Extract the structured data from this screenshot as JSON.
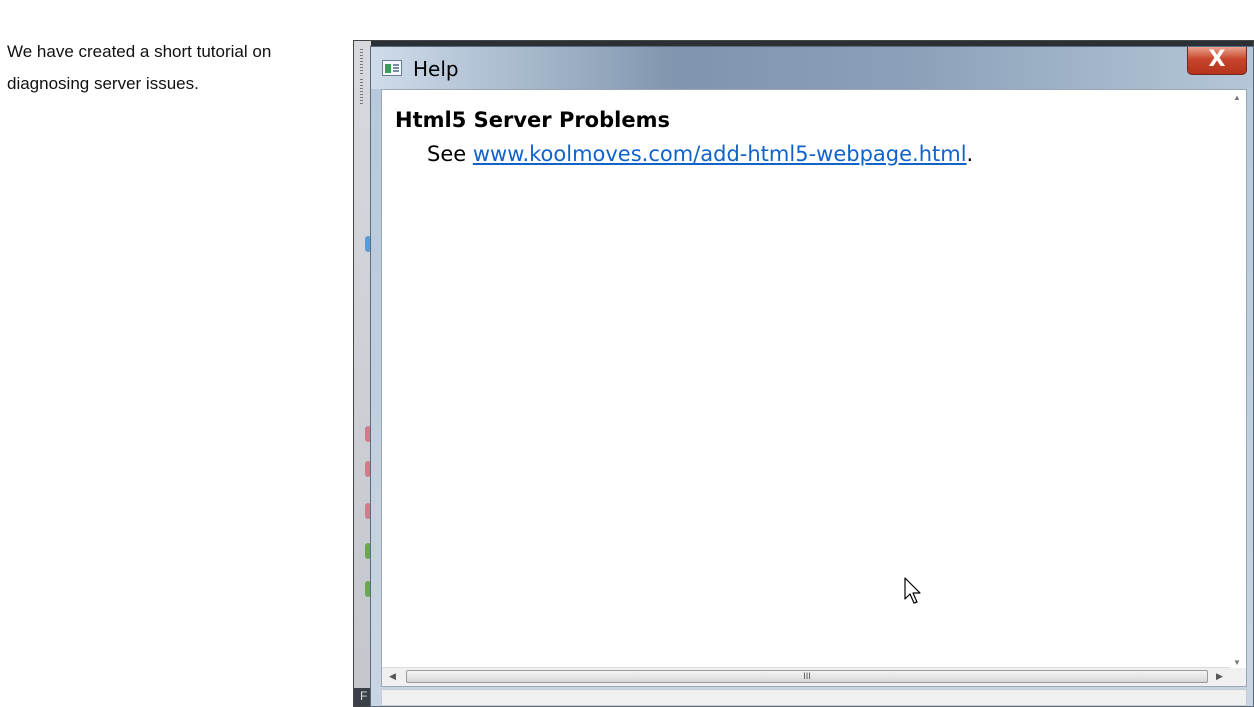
{
  "intro": {
    "line1": "We have created a short tutorial on",
    "line2": "diagnosing server issues."
  },
  "background_app": {
    "status_text": "F"
  },
  "help_window": {
    "title": "Help",
    "close_label": "X",
    "heading": "Html5 Server Problems",
    "see_prefix": "See",
    "link_text": "www.koolmoves.com/add-html5-webpage.html",
    "see_suffix": ".",
    "scroll_grip": "III"
  },
  "icons": [
    "help-window-icon",
    "close-icon",
    "mouse-pointer-icon"
  ]
}
